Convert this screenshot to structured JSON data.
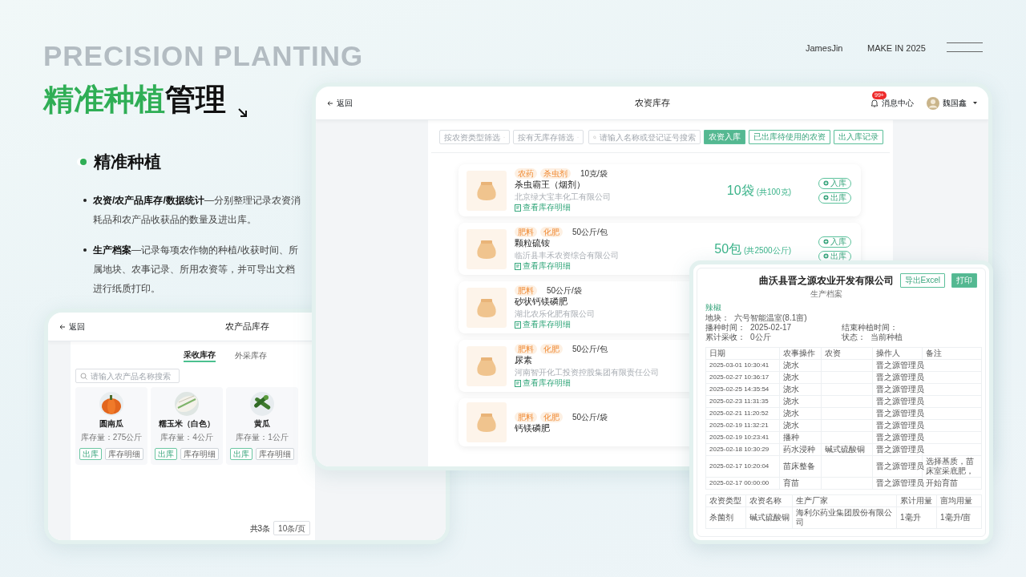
{
  "slide": {
    "overline": "PRECISION PLANTING",
    "title_highlight": "精准种植",
    "title_rest": "管理",
    "author": "JamesJin",
    "tagline": "MAKE IN 2025",
    "section_title": "精准种植",
    "bullets": [
      "**农资/农产品库存/数据统计**—分别整理记录农资消耗品和农产品收获品的数量及进出库。",
      "**生产档案**—记录每项农作物的种植/收获时间、所属地块、农事记录、所用农资等，并可导出文档进行纸质打印。"
    ]
  },
  "inventory_screen": {
    "back": "返回",
    "title": "农资库存",
    "notification": {
      "badge": "99+",
      "label": "消息中心"
    },
    "user": {
      "name": "魏国鑫"
    },
    "filters": [
      {
        "kind": "select",
        "placeholder": "按农资类型筛选"
      },
      {
        "kind": "select",
        "placeholder": "按有无库存筛选"
      },
      {
        "kind": "search",
        "placeholder": "请输入名称或登记证号搜索"
      }
    ],
    "actions": [
      {
        "label": "农资入库",
        "primary": true
      },
      {
        "label": "已出库待使用的农资",
        "primary": false
      },
      {
        "label": "出入库记录",
        "primary": false
      }
    ],
    "items": [
      {
        "tags": [
          "农药",
          "杀虫剂"
        ],
        "spec": "10克/袋",
        "name": "杀虫霸王（烟剂）",
        "company": "北京绿大宝丰化工有限公司",
        "link": "查看库存明细",
        "stock": "10袋",
        "stock_total": "(共100克)",
        "buttons": [
          "入库",
          "出库"
        ]
      },
      {
        "tags": [
          "肥料",
          "化肥"
        ],
        "spec": "50公斤/包",
        "name": "颗粒硫铵",
        "company": "临沂县丰禾农资综合有限公司",
        "link": "查看库存明细",
        "stock": "50包",
        "stock_total": "(共2500公斤)",
        "buttons": [
          "入库",
          "出库"
        ]
      },
      {
        "tags": [
          "肥料"
        ],
        "spec": "50公斤/袋",
        "name": "砂状钙镁磷肥",
        "company": "湖北农乐化肥有限公司",
        "link": "查看库存明细"
      },
      {
        "tags": [
          "肥料",
          "化肥"
        ],
        "spec": "50公斤/包",
        "name": "尿素",
        "company": "河南智开化工投资控股集团有限责任公司",
        "link": "查看库存明细"
      },
      {
        "tags": [
          "肥料",
          "化肥"
        ],
        "spec": "50公斤/袋",
        "name": "钙镁磷肥"
      }
    ]
  },
  "produce_screen": {
    "back": "返回",
    "title": "农产品库存",
    "tabs": [
      {
        "label": "采收库存",
        "selected": true
      },
      {
        "label": "外采库存",
        "selected": false
      }
    ],
    "search": {
      "placeholder": "请输入农产品名称搜索"
    },
    "items": [
      {
        "name": "圆南瓜",
        "stock": "库存量：275公斤",
        "buttons": [
          "出库",
          "库存明细"
        ]
      },
      {
        "name": "糯玉米（白色）",
        "stock": "库存量：4公斤",
        "buttons": [
          "出库",
          "库存明细"
        ]
      },
      {
        "name": "黄瓜",
        "stock": "库存量：1公斤",
        "buttons": [
          "出库",
          "库存明细"
        ]
      }
    ],
    "pagination": {
      "total": "共3条",
      "page_size": "10条/页"
    }
  },
  "archive_doc": {
    "company": "曲沃县晋之源农业开发有限公司",
    "subtitle": "生产档案",
    "buttons": [
      {
        "label": "导出Excel",
        "primary": false
      },
      {
        "label": "打印",
        "primary": true
      }
    ],
    "crop": "辣椒",
    "info": [
      [
        {
          "label": "地块：",
          "value": "六号智能温室(8.1亩)"
        }
      ],
      [
        {
          "label": "播种时间：",
          "value": "2025-02-17"
        },
        {
          "label": "结束种植时间："
        }
      ],
      [
        {
          "label": "累计采收：",
          "value": "0公斤"
        },
        {
          "label": "状态：",
          "value": "当前种植"
        }
      ]
    ],
    "records": {
      "columns": [
        "日期",
        "农事操作",
        "农资",
        "操作人",
        "备注"
      ],
      "rows": [
        {
          "date": "2025-03-01 10:30:41",
          "operation": "浇水",
          "operator": "晋之源管理员"
        },
        {
          "date": "2025-02-27 10:36:17",
          "operation": "浇水",
          "operator": "晋之源管理员"
        },
        {
          "date": "2025-02-25 14:35:54",
          "operation": "浇水",
          "operator": "晋之源管理员"
        },
        {
          "date": "2025-02-23 11:31:35",
          "operation": "浇水",
          "operator": "晋之源管理员"
        },
        {
          "date": "2025-02-21 11:20:52",
          "operation": "浇水",
          "operator": "晋之源管理员"
        },
        {
          "date": "2025-02-19 11:32:21",
          "operation": "浇水",
          "operator": "晋之源管理员"
        },
        {
          "date": "2025-02-19 10:23:41",
          "operation": "播种",
          "operator": "晋之源管理员"
        },
        {
          "date": "2025-02-18 10:30:29",
          "operation": "药水浸种",
          "material": "碱式硫酸铜",
          "operator": "晋之源管理员"
        },
        {
          "date": "2025-02-17 10:20:04",
          "operation": "苗床整备",
          "operator": "晋之源管理员",
          "note": "选择基质，苗床室采底肥，"
        },
        {
          "date": "2025-02-17 00:00:00",
          "operation": "育苗",
          "operator": "晋之源管理员",
          "note": "开始育苗"
        }
      ]
    },
    "materials": {
      "columns": [
        "农资类型",
        "农资名称",
        "生产厂家",
        "累计用量",
        "亩均用量"
      ],
      "rows": [
        {
          "type": "杀菌剂",
          "name": "碱式硫酸铜",
          "maker": "海利尔药业集团股份有限公司",
          "total": "1毫升",
          "per_mu": "1毫升/亩"
        }
      ]
    }
  }
}
